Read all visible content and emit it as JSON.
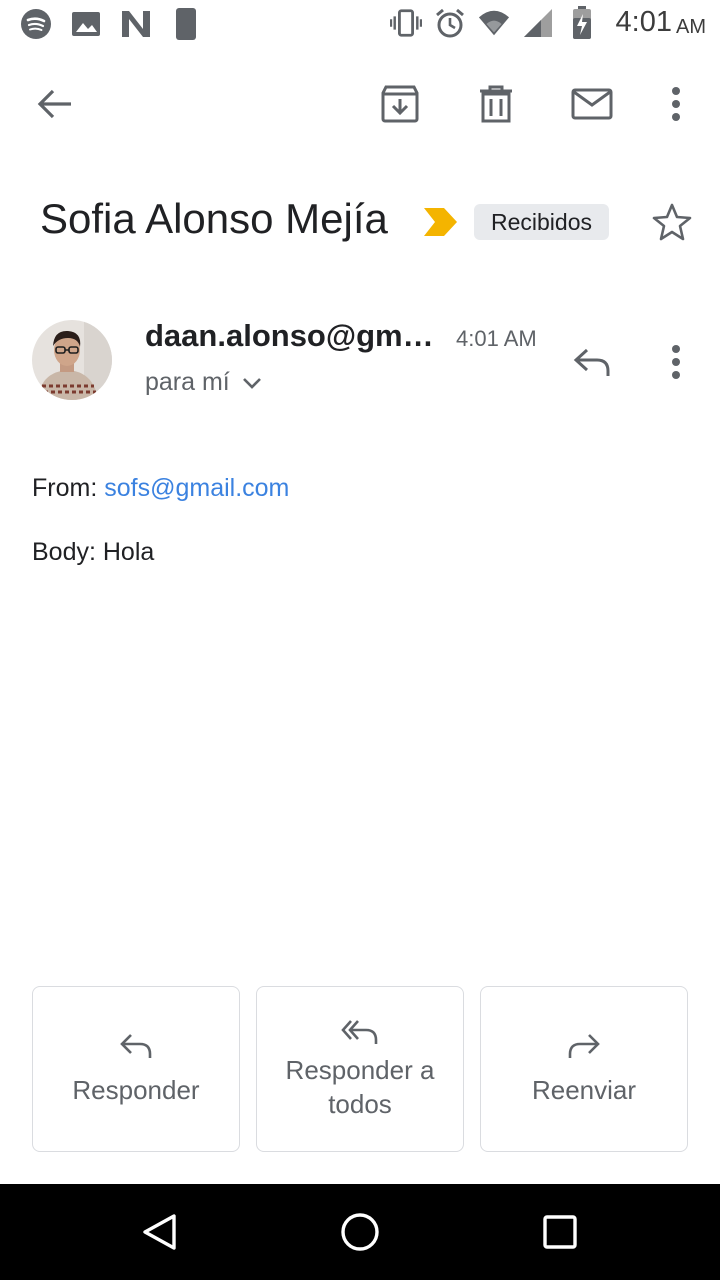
{
  "status_bar": {
    "icons": [
      "spotify-icon",
      "image-icon",
      "n-app-icon",
      "sleep-mode-icon",
      "vibrate-icon",
      "alarm-icon",
      "wifi-icon",
      "signal-icon",
      "battery-charging-icon"
    ],
    "time": "4:01",
    "ampm": "AM"
  },
  "toolbar": {
    "icons": [
      "back-arrow-icon",
      "archive-icon",
      "delete-icon",
      "mark-unread-icon",
      "more-vert-icon"
    ]
  },
  "email": {
    "subject": "Sofia Alonso Mejía",
    "label": "Recibidos",
    "importance_color": "#f4b400",
    "sender": "daan.alonso@gma…",
    "time": "4:01 AM",
    "recipient": "para mí",
    "from_label": "From:",
    "from_email": "sofs@gmail.com",
    "body_text": "Body: Hola"
  },
  "actions": {
    "reply": "Responder",
    "reply_all": "Responder a todos",
    "forward": "Reenviar"
  },
  "colors": {
    "link": "#3b82e0",
    "chip": "#e8eaed",
    "navbar": "#000000"
  }
}
